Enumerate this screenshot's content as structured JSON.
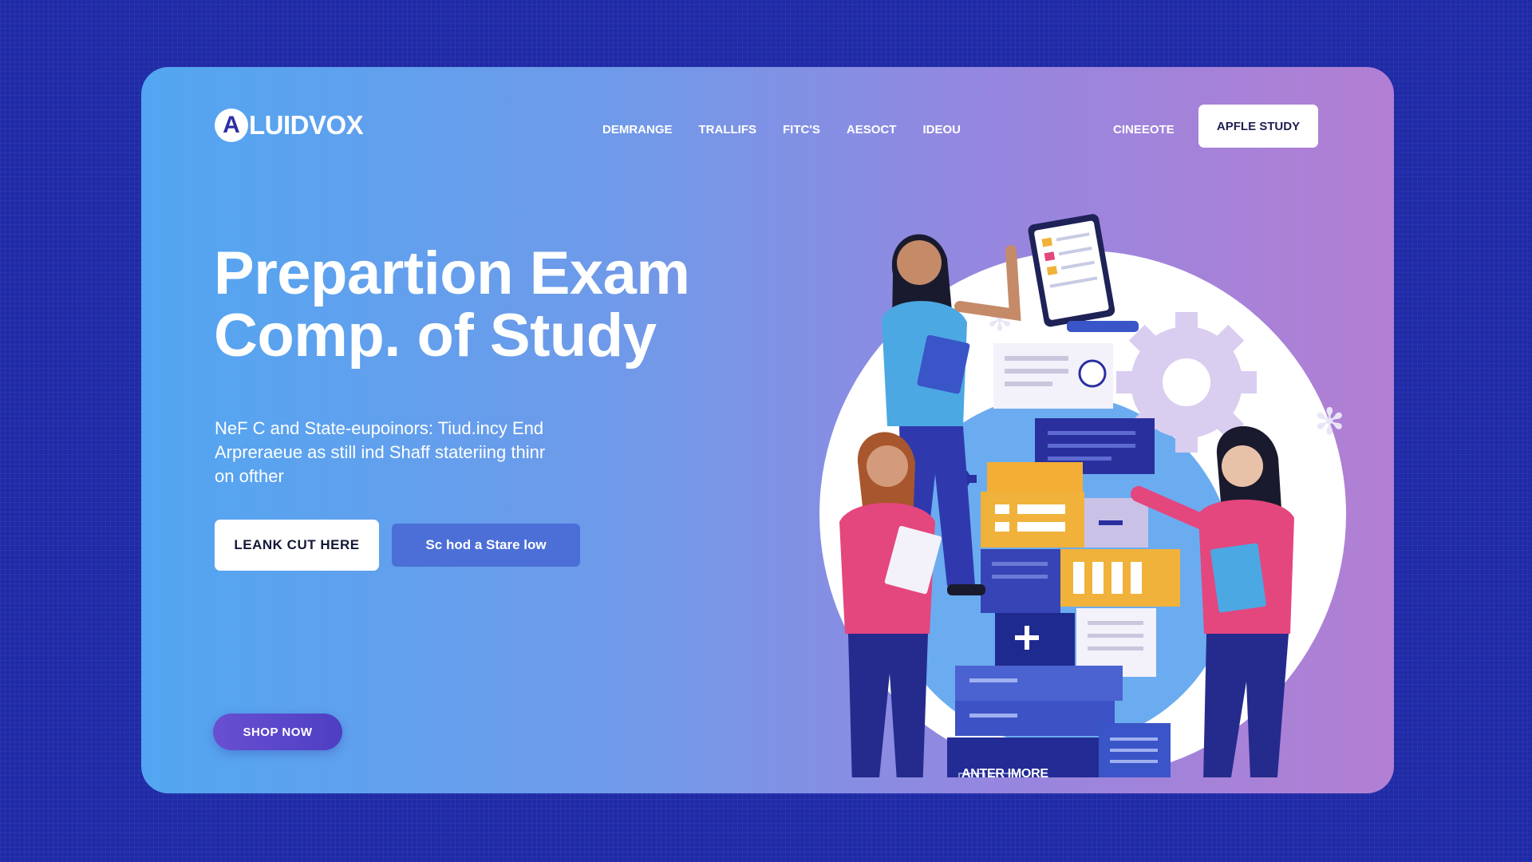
{
  "brand": {
    "logo_letter": "A",
    "name": "LUIDVOX"
  },
  "nav": {
    "items": [
      {
        "label": "DEMRANGE"
      },
      {
        "label": "TRALLIFS"
      },
      {
        "label": "FITC'S"
      },
      {
        "label": "AESOCT"
      },
      {
        "label": "IDEOU"
      }
    ],
    "right_link": "CINEEOTE",
    "cta_label": "APFLE STUDY"
  },
  "hero": {
    "title_lines": [
      "Prepartion Exam",
      "Comp. of Study"
    ],
    "description_lines": [
      "NeF C and State-eupoinors: Tiud.incy End",
      "Arpreraeue as still ind Shaff stateriing thinr",
      "on ofther"
    ],
    "primary_button": "LEANK CUT HERE",
    "secondary_button": "Sc hod a Stare low",
    "shop_button": "SHOP NOW"
  },
  "illustration": {
    "box_label": "ANTER IMORE",
    "icons": [
      "gear-icon",
      "snowflake-icon",
      "star-icon",
      "plus-icon"
    ]
  },
  "colors": {
    "page_background": "#1f2aa6",
    "card_gradient_start": "#52a6f1",
    "card_gradient_end": "#b27fd3",
    "accent_blue": "#4c6fd7",
    "accent_pink": "#e4467e",
    "accent_navy": "#2a2f9e",
    "accent_yellow": "#f0b23a"
  }
}
